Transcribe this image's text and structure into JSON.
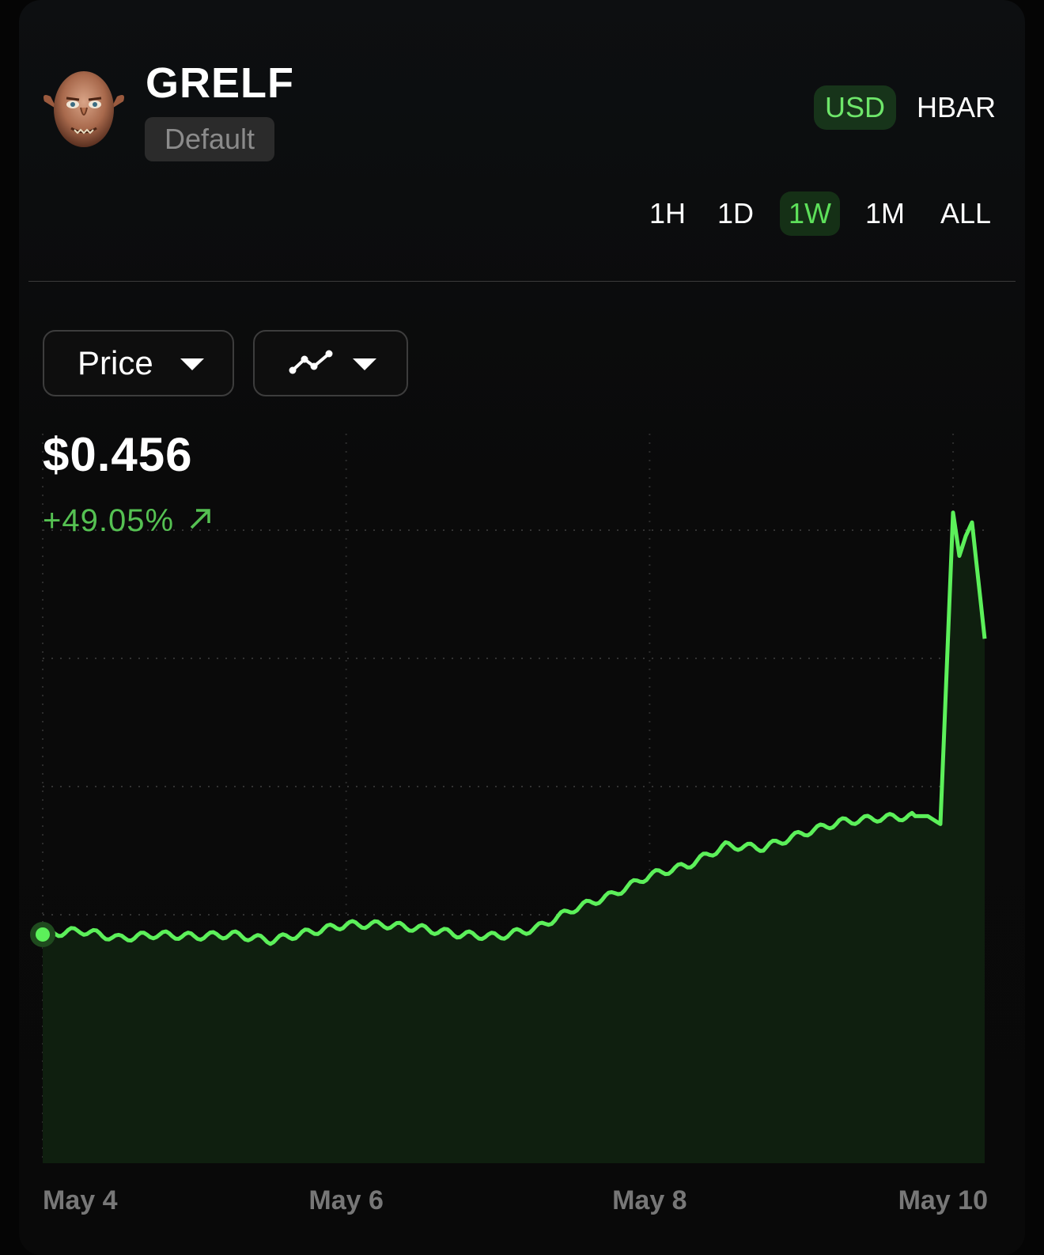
{
  "token": {
    "name": "GRELF",
    "badge": "Default",
    "avatar_icon": "goblin-face-avatar"
  },
  "currency_toggle": {
    "options": [
      "USD",
      "HBAR"
    ],
    "selected": "USD"
  },
  "time_ranges": {
    "options": [
      "1H",
      "1D",
      "1W",
      "1M",
      "ALL"
    ],
    "selected": "1W"
  },
  "controls": {
    "metric_dropdown": "Price",
    "chart_type_icon": "line-chart-icon"
  },
  "summary": {
    "price": "$0.456",
    "change": "+49.05%",
    "change_icon": "arrow-up-right-icon"
  },
  "colors": {
    "accent": "#5de05a",
    "line": "#5cf05a",
    "area": "#0f1f0f"
  },
  "chart_data": {
    "type": "area",
    "x_tick_labels": [
      "May 4",
      "May 6",
      "May 8",
      "May 10"
    ],
    "x": [
      "May 4 00:00",
      "May 4 06:00",
      "May 4 12:00",
      "May 4 18:00",
      "May 5 00:00",
      "May 5 06:00",
      "May 5 12:00",
      "May 5 18:00",
      "May 6 00:00",
      "May 6 06:00",
      "May 6 12:00",
      "May 6 18:00",
      "May 7 00:00",
      "May 7 06:00",
      "May 7 12:00",
      "May 7 18:00",
      "May 8 00:00",
      "May 8 06:00",
      "May 8 12:00",
      "May 8 18:00",
      "May 9 00:00",
      "May 9 06:00",
      "May 9 12:00",
      "May 9 18:00",
      "May 10 00:00"
    ],
    "values": [
      0.306,
      0.308,
      0.304,
      0.306,
      0.305,
      0.306,
      0.303,
      0.307,
      0.311,
      0.311,
      0.309,
      0.306,
      0.305,
      0.309,
      0.319,
      0.326,
      0.336,
      0.341,
      0.351,
      0.35,
      0.357,
      0.363,
      0.365,
      0.366,
      0.456
    ],
    "spike": {
      "x": [
        "May 9 20:00",
        "May 9 22:00",
        "May 10 00:00",
        "May 10 01:00",
        "May 10 02:00",
        "May 10 03:00",
        "May 10 05:00"
      ],
      "values": [
        0.366,
        0.362,
        0.52,
        0.498,
        0.508,
        0.515,
        0.456
      ]
    },
    "grid": true,
    "legend": "none"
  }
}
